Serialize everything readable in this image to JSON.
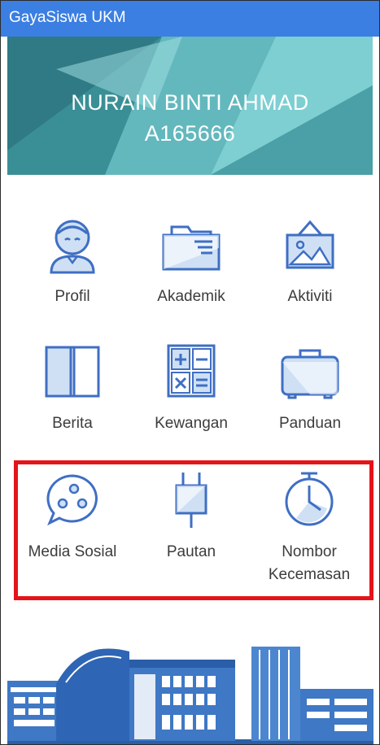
{
  "app_bar": {
    "title": "GayaSiswa UKM"
  },
  "profile": {
    "name": "NURAIN BINTI AHMAD",
    "id": "A165666"
  },
  "menu": [
    {
      "label": "Profil",
      "icon": "person-icon"
    },
    {
      "label": "Akademik",
      "icon": "folder-icon"
    },
    {
      "label": "Aktiviti",
      "icon": "picture-frame-icon"
    },
    {
      "label": "Berita",
      "icon": "book-icon"
    },
    {
      "label": "Kewangan",
      "icon": "calculator-icon"
    },
    {
      "label": "Panduan",
      "icon": "suitcase-icon"
    },
    {
      "label": "Media Sosial",
      "icon": "chat-bubble-icon"
    },
    {
      "label": "Pautan",
      "icon": "plug-icon"
    },
    {
      "label": "Nombor Kecemasan",
      "icon": "alarm-clock-icon"
    }
  ],
  "colors": {
    "app_bar": "#3b7fe2",
    "icon_stroke": "#3f6fc3",
    "icon_fill": "#cfe0f5",
    "highlight": "#e5141a"
  }
}
